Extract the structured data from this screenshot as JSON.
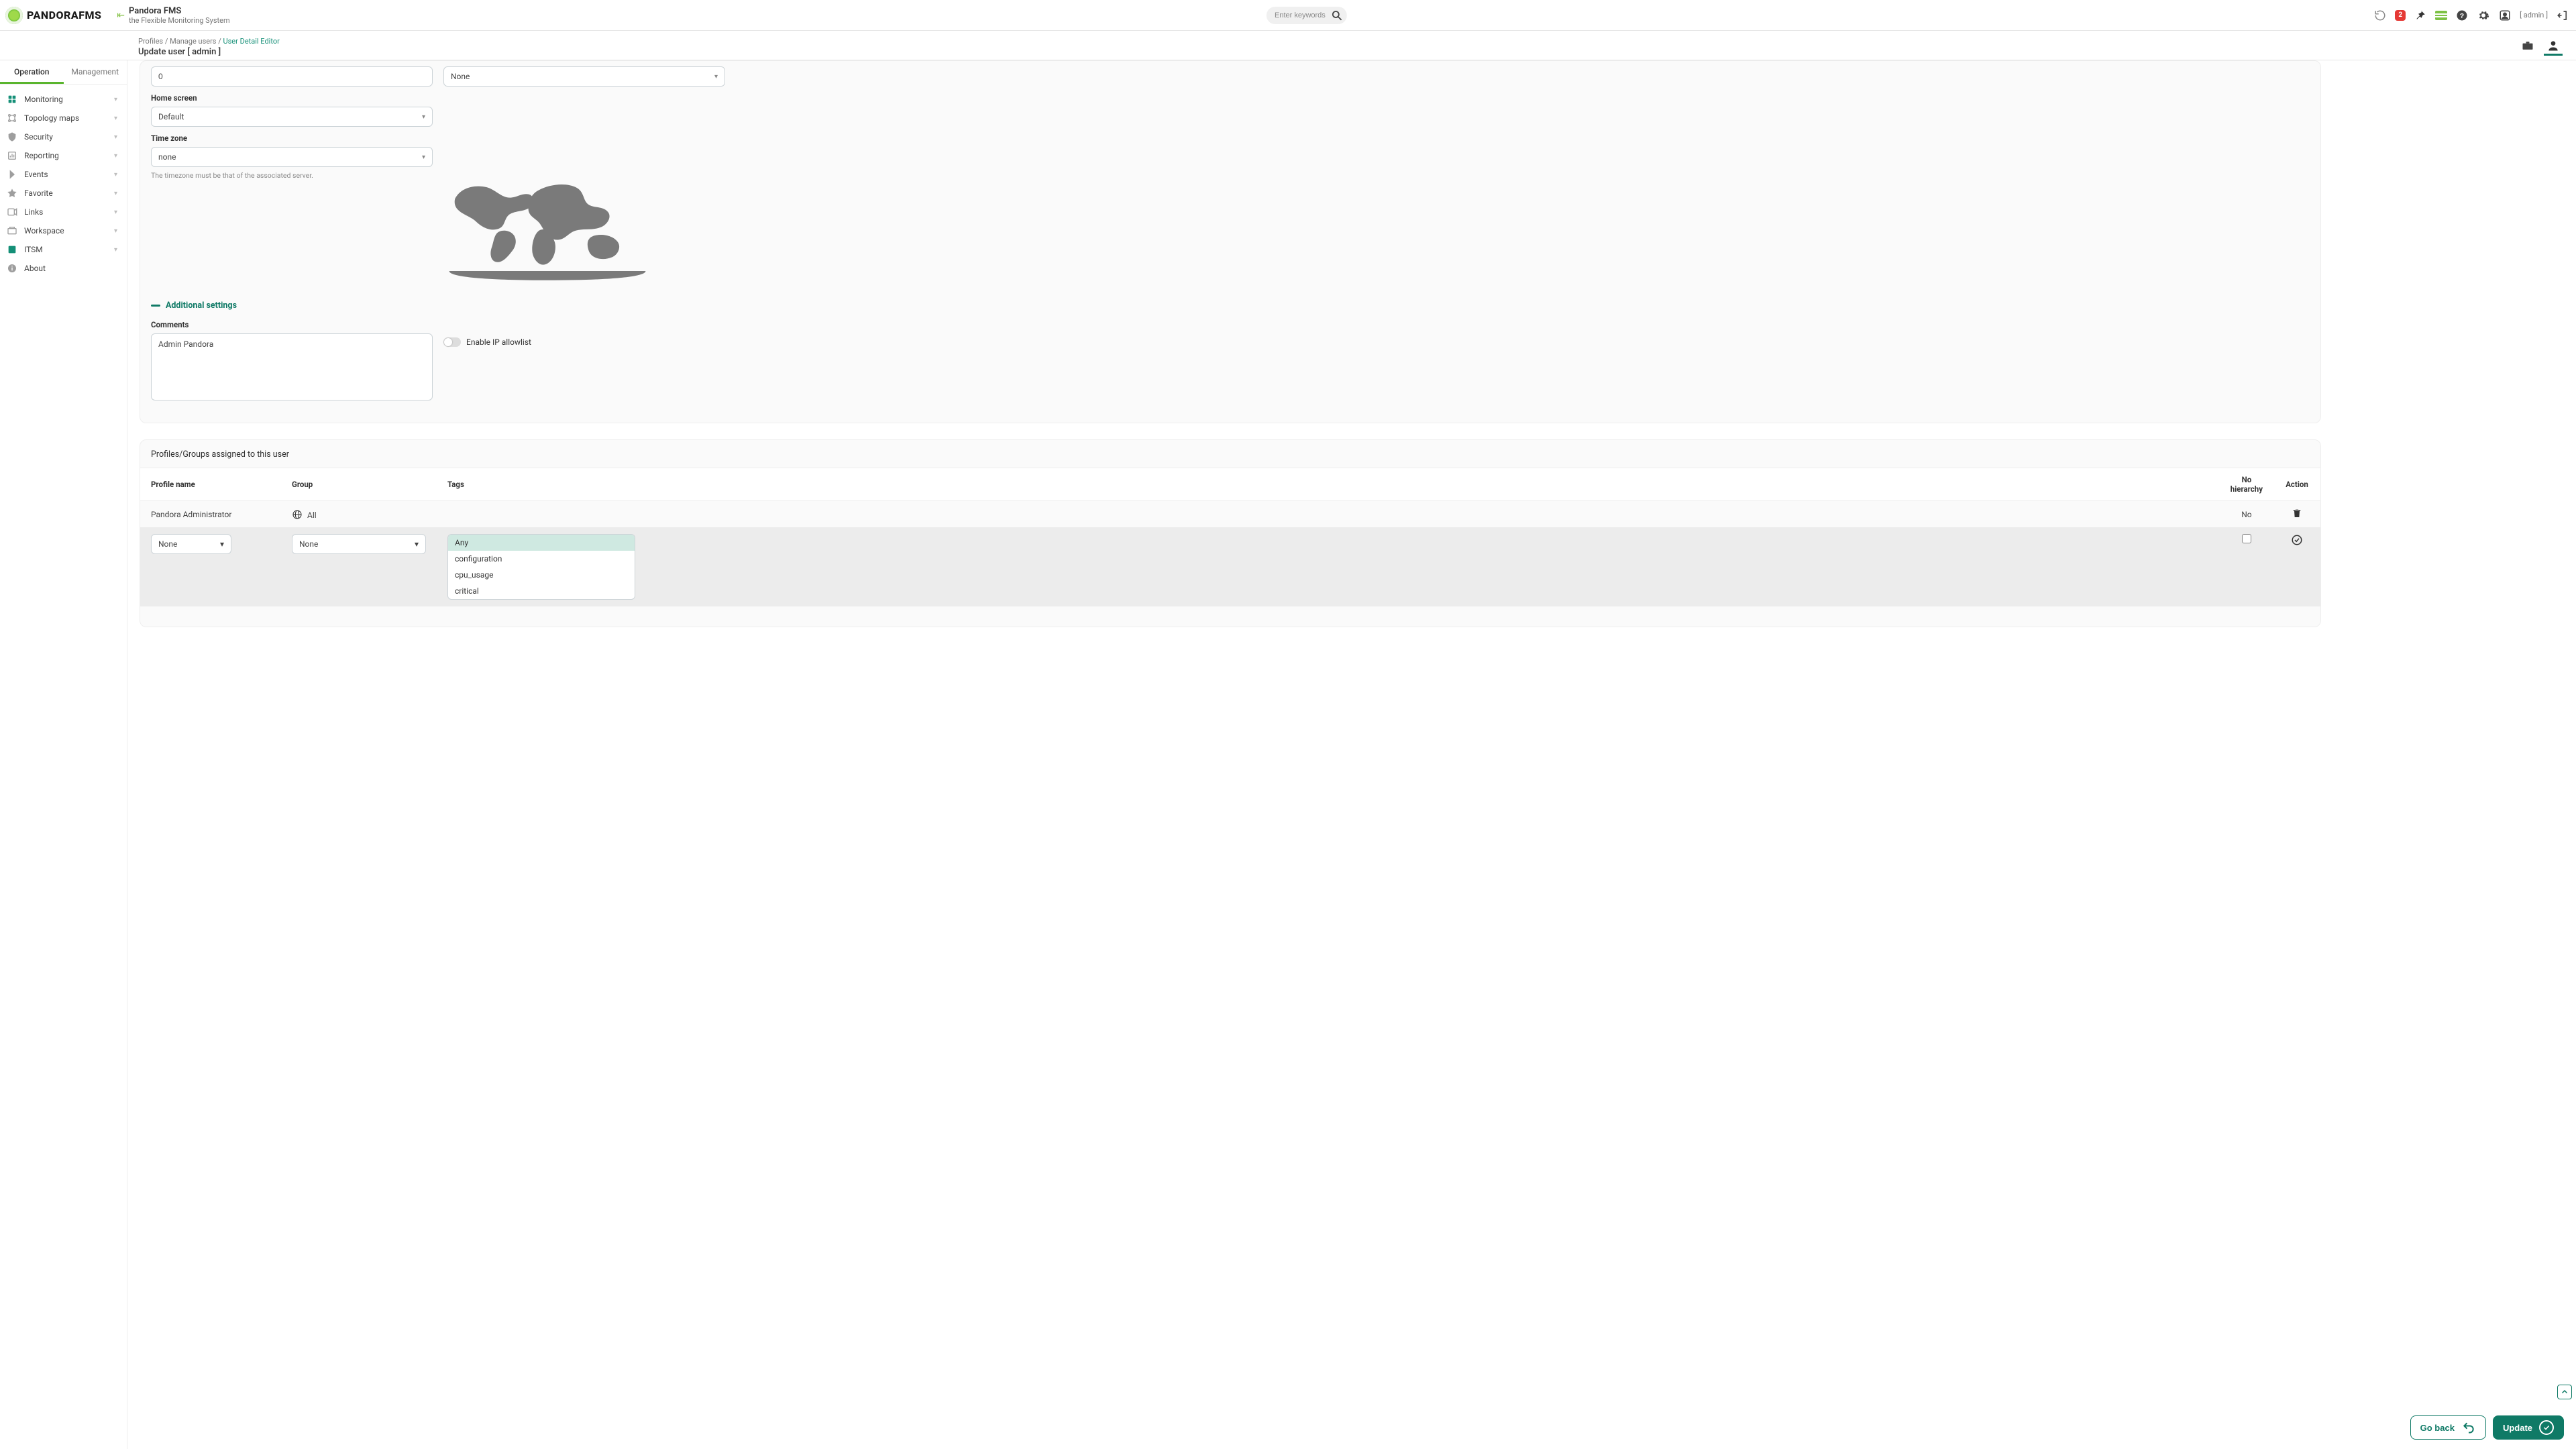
{
  "header": {
    "brand_text": "PANDORA",
    "brand_suffix": "FMS",
    "title": "Pandora FMS",
    "subtitle": "the Flexible Monitoring System",
    "search_placeholder": "Enter keywords",
    "notif_badge": "2",
    "user_label": "[ admin ]"
  },
  "breadcrumb": {
    "a": "Profiles",
    "b": "Manage users",
    "c": "User Detail Editor",
    "title": "Update user [ admin ]"
  },
  "sidebar": {
    "tab_operation": "Operation",
    "tab_management": "Management",
    "items": [
      {
        "label": "Monitoring",
        "accent": true
      },
      {
        "label": "Topology maps",
        "accent": false
      },
      {
        "label": "Security",
        "accent": false
      },
      {
        "label": "Reporting",
        "accent": false
      },
      {
        "label": "Events",
        "accent": false
      },
      {
        "label": "Favorite",
        "accent": false
      },
      {
        "label": "Links",
        "accent": false
      },
      {
        "label": "Workspace",
        "accent": false
      },
      {
        "label": "ITSM",
        "accent": true
      },
      {
        "label": "About",
        "accent": false,
        "no_chev": true
      }
    ]
  },
  "form": {
    "field_num_value": "0",
    "field_right_value": "None",
    "home_label": "Home screen",
    "home_value": "Default",
    "tz_label": "Time zone",
    "tz_value": "none",
    "tz_hint": "The timezone must be that of the associated server.",
    "section_additional": "Additional settings",
    "comments_label": "Comments",
    "comments_value": "Admin Pandora",
    "allowlist_label": "Enable IP allowlist"
  },
  "profiles": {
    "heading": "Profiles/Groups assigned to this user",
    "col_profile": "Profile name",
    "col_group": "Group",
    "col_tags": "Tags",
    "col_noh": "No hierarchy",
    "col_action": "Action",
    "row1_profile": "Pandora Administrator",
    "row1_group": "All",
    "row1_noh": "No",
    "edit_profile_value": "None",
    "edit_group_value": "None",
    "tag_options": [
      "Any",
      "configuration",
      "cpu_usage",
      "critical"
    ],
    "tag_selected_index": 0
  },
  "footer": {
    "go_back": "Go back",
    "update": "Update"
  }
}
